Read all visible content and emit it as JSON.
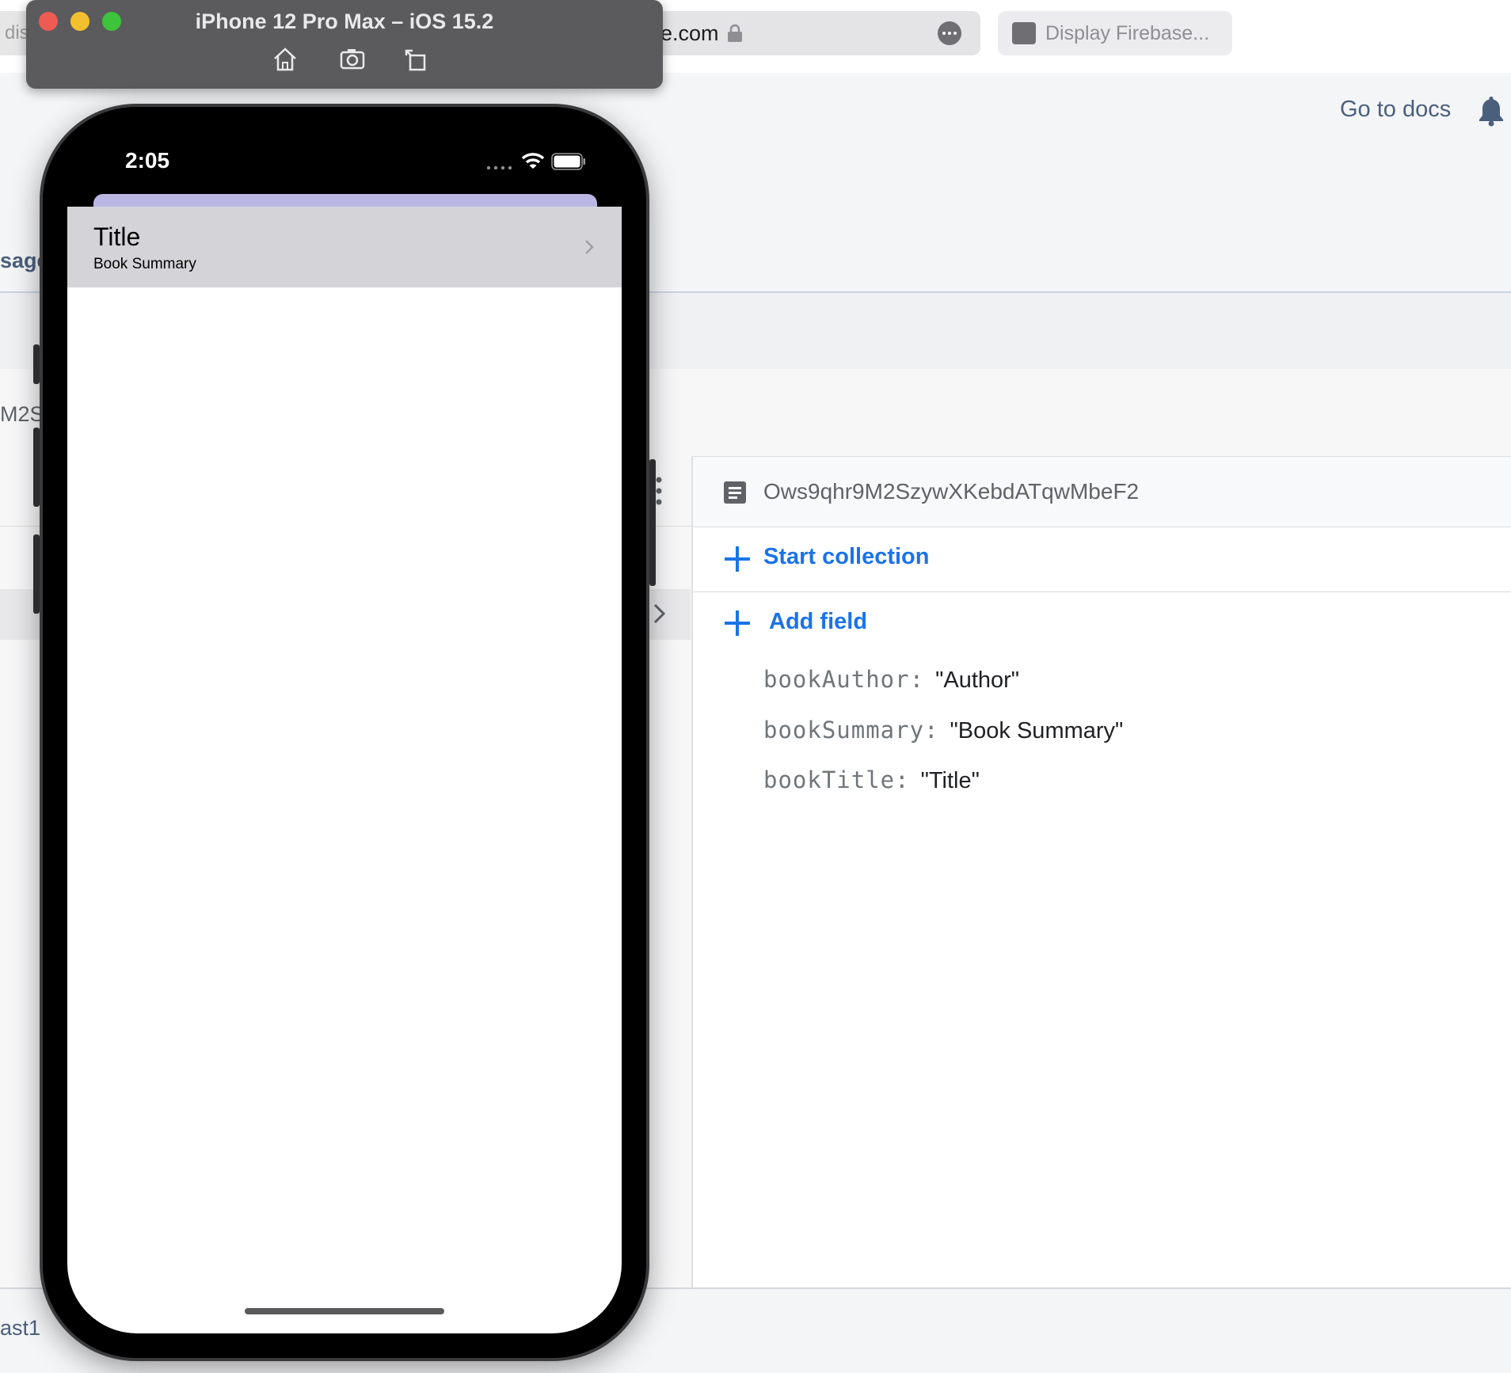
{
  "browser": {
    "left_tab_fragment": "dis",
    "address_fragment": "e.com",
    "right_tab_label": "Display Firebase..."
  },
  "firebase": {
    "go_to_docs": "Go to docs",
    "left_fragments": {
      "usage": "sage",
      "id": "M2S",
      "region": "ast1"
    },
    "document": {
      "id": "Ows9qhr9M2SzywXKebdATqwMbeF2",
      "start_collection": "Start collection",
      "add_field": "Add field",
      "fields": [
        {
          "key": "bookAuthor:",
          "value": "\"Author\""
        },
        {
          "key": "bookSummary:",
          "value": "\"Book Summary\""
        },
        {
          "key": "bookTitle:",
          "value": "\"Title\""
        }
      ]
    }
  },
  "simulator": {
    "title": "iPhone 12 Pro Max – iOS 15.2",
    "status_time": "2:05",
    "list_item": {
      "title": "Title",
      "subtitle": "Book Summary"
    }
  },
  "colors": {
    "accent": "#1a73e8",
    "traffic_close": "#ee5b52",
    "traffic_minimize": "#f3bf2e",
    "traffic_zoom": "#3ec43a"
  },
  "icons": [
    "lock-icon",
    "more-icon",
    "tab-favicon-icon",
    "bell-icon",
    "document-icon",
    "plus-icon",
    "chevron-right-icon",
    "more-vertical-icon",
    "home-icon",
    "screenshot-icon",
    "rotate-icon",
    "wifi-icon",
    "battery-icon",
    "signal-icon"
  ]
}
